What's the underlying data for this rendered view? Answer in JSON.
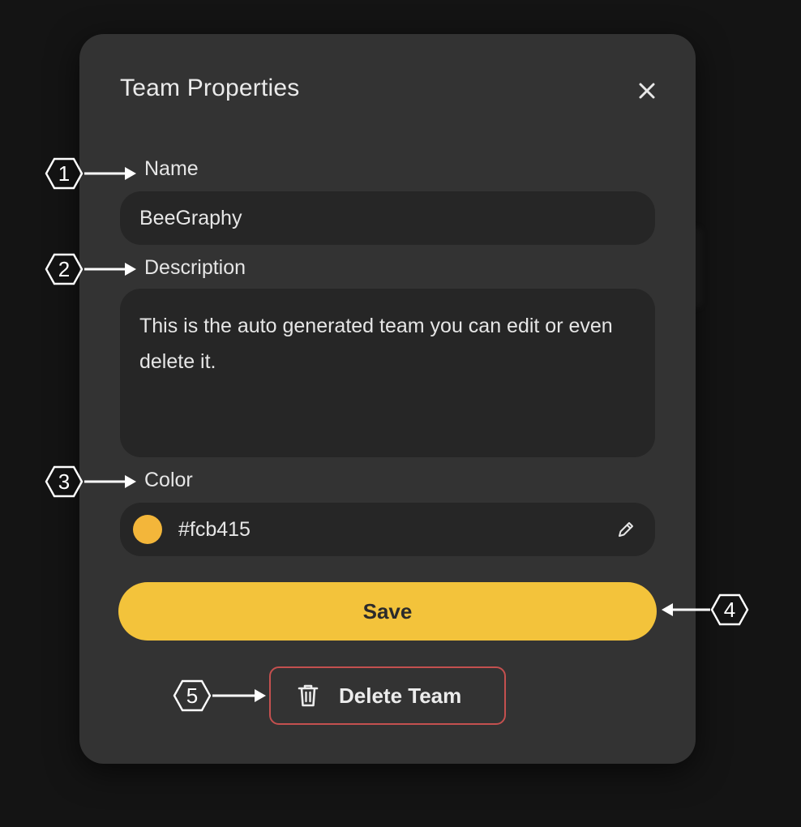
{
  "dialog": {
    "title": "Team Properties",
    "close_icon": "close-icon"
  },
  "fields": {
    "name_label": "Name",
    "name_value": "BeeGraphy",
    "description_label": "Description",
    "description_value": "This is the auto generated team you can edit or even delete it.",
    "color_label": "Color",
    "color_value": "#fcb415",
    "color_swatch": "#f3b63a",
    "edit_icon": "pencil-icon"
  },
  "actions": {
    "save_label": "Save",
    "delete_label": "Delete Team",
    "delete_icon": "trash-icon"
  },
  "annotations": [
    "1",
    "2",
    "3",
    "4",
    "5"
  ],
  "colors": {
    "accent": "#f3c33b",
    "danger_border": "#c4504f",
    "dialog_bg": "#333333",
    "field_bg": "#262626"
  }
}
